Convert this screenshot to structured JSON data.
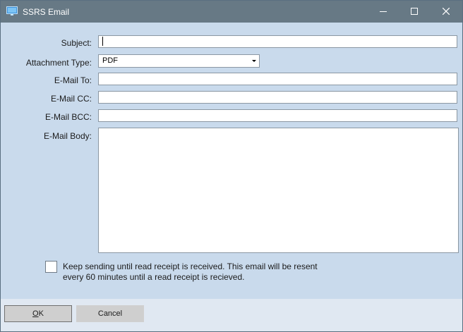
{
  "window": {
    "title": "SSRS Email",
    "app_icon": "monitor-icon",
    "controls": {
      "minimize": "minimize-icon",
      "maximize": "maximize-icon",
      "close": "close-icon"
    }
  },
  "form": {
    "subject": {
      "label": "Subject:",
      "value": ""
    },
    "attachment_type": {
      "label": "Attachment Type:",
      "selected": "PDF"
    },
    "email_to": {
      "label": "E-Mail To:",
      "value": ""
    },
    "email_cc": {
      "label": "E-Mail CC:",
      "value": ""
    },
    "email_bcc": {
      "label": "E-Mail BCC:",
      "value": ""
    },
    "email_body": {
      "label": "E-Mail Body:",
      "value": ""
    },
    "keep_sending": {
      "checked": false,
      "text": "Keep sending until read receipt is received.  This email will be resent every 60 minutes until a read receipt is recieved."
    }
  },
  "buttons": {
    "ok": "OK",
    "cancel": "Cancel"
  },
  "colors": {
    "titlebar": "#677985",
    "client_background": "#c9daec",
    "footer_background": "#e0e8f2"
  }
}
